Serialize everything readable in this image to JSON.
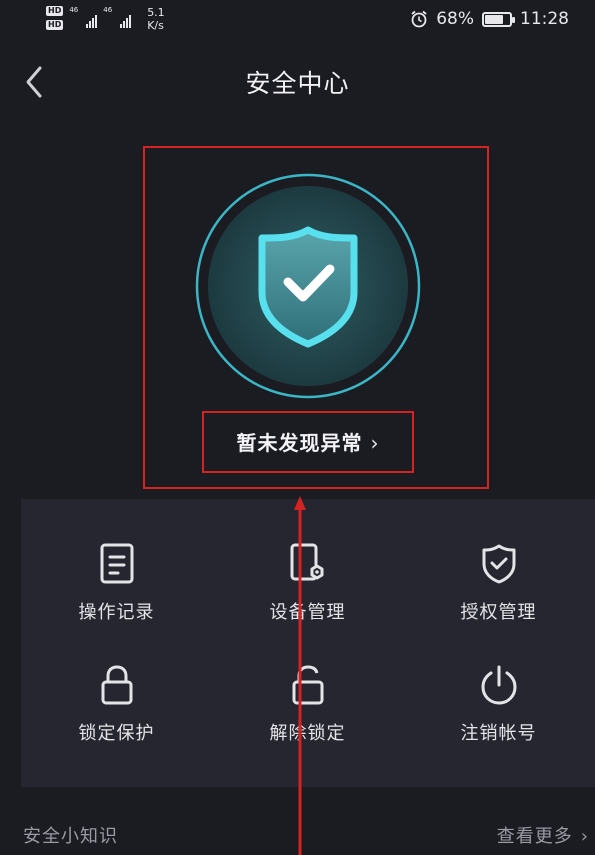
{
  "status_bar": {
    "hd_1": "HD",
    "hd_2": "HD",
    "network_1": "46",
    "network_2": "46",
    "speed_value": "5.1",
    "speed_unit": "K/s",
    "battery_percent": "68%",
    "battery_level": 0.68,
    "time": "11:28",
    "icons": [
      "alarm-icon",
      "battery-icon",
      "signal-icon"
    ]
  },
  "header": {
    "title": "安全中心",
    "back_icon": "chevron-left-icon"
  },
  "hero": {
    "status_text": "暂未发现异常",
    "status_chevron": "›",
    "shield_icon": "shield-check-icon"
  },
  "grid": {
    "items": [
      {
        "label": "操作记录",
        "icon": "document-icon"
      },
      {
        "label": "设备管理",
        "icon": "device-settings-icon"
      },
      {
        "label": "授权管理",
        "icon": "shield-check-outline-icon"
      },
      {
        "label": "锁定保护",
        "icon": "lock-icon"
      },
      {
        "label": "解除锁定",
        "icon": "unlock-icon"
      },
      {
        "label": "注销帐号",
        "icon": "power-icon"
      }
    ]
  },
  "footer": {
    "tips_label": "安全小知识",
    "more_label": "查看更多",
    "more_chevron": "›"
  },
  "colors": {
    "background": "#1b1b22",
    "panel": "#262630",
    "accent_cyan": "#4fd1e0",
    "annotation_red": "#d42323"
  }
}
